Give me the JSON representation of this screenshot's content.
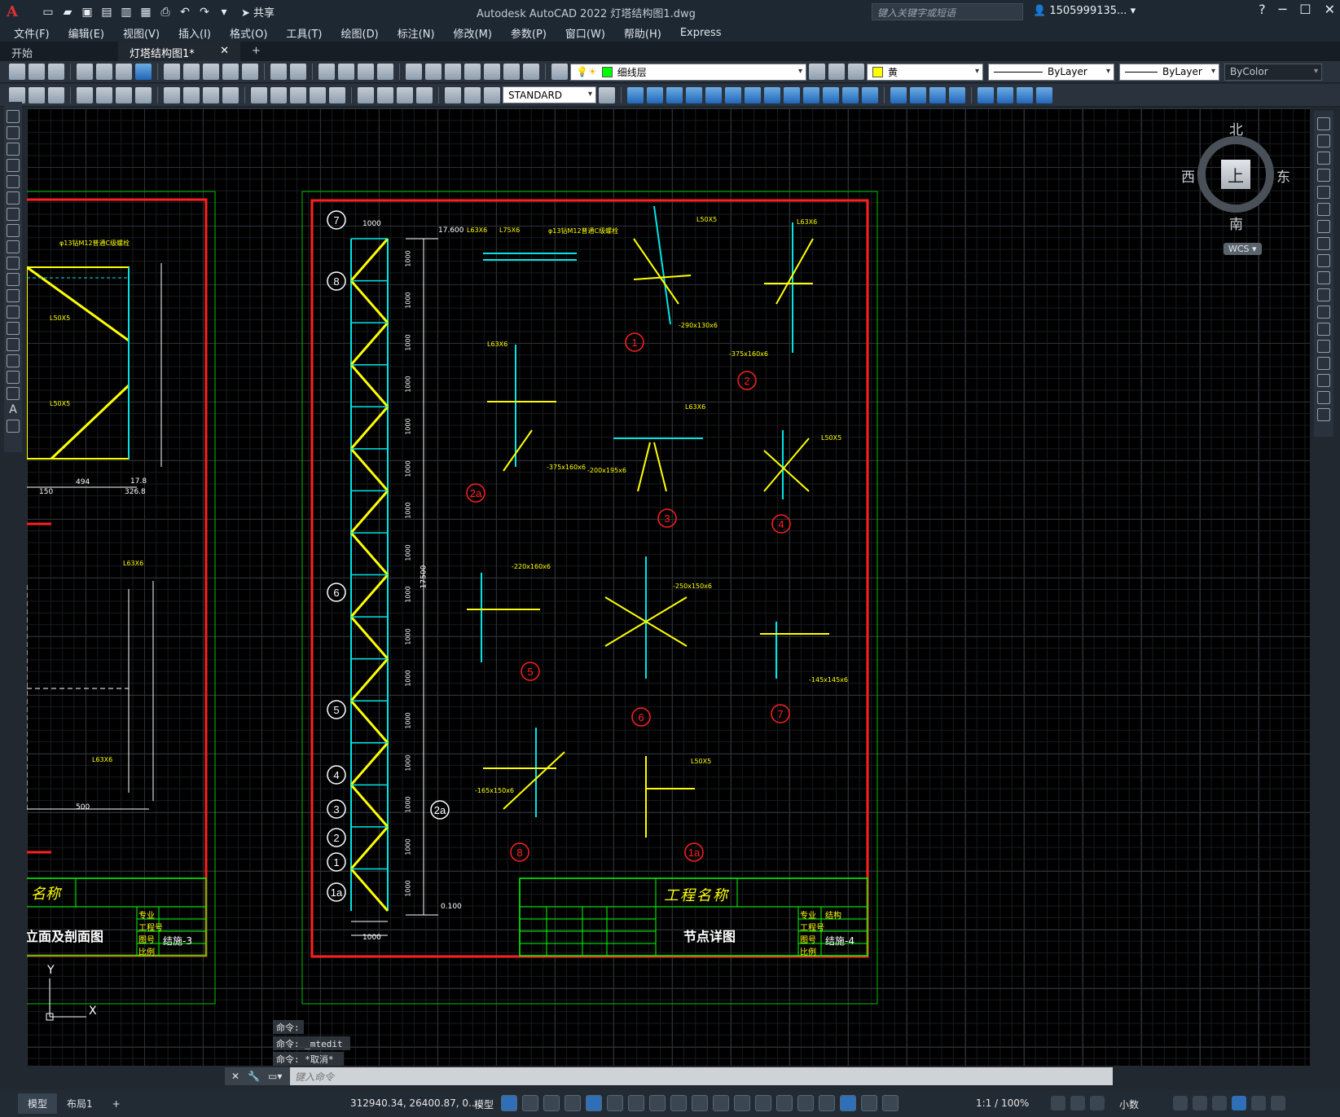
{
  "app": {
    "logo": "A",
    "title": "Autodesk AutoCAD 2022    灯塔结构图1.dwg",
    "share": "共享",
    "search_placeholder": "键入关键字或短语",
    "user": "1505999135...",
    "help": "?"
  },
  "menu": [
    "文件(F)",
    "编辑(E)",
    "视图(V)",
    "插入(I)",
    "格式(O)",
    "工具(T)",
    "绘图(D)",
    "标注(N)",
    "修改(M)",
    "参数(P)",
    "窗口(W)",
    "帮助(H)",
    "Express"
  ],
  "tabs": [
    {
      "label": "开始",
      "active": false
    },
    {
      "label": "灯塔结构图1*",
      "active": true
    }
  ],
  "toolbar": {
    "layer": "细线层",
    "layer_color": "#00ff00",
    "color": "黄",
    "color_swatch": "#ffff00",
    "linetype": "ByLayer",
    "lineweight": "ByLayer",
    "plotstyle": "ByColor",
    "textstyle": "STANDARD"
  },
  "viewcube": {
    "north": "北",
    "south": "南",
    "east": "东",
    "west": "西",
    "face": "上",
    "wcs": "WCS"
  },
  "drawing": {
    "left_sheet": {
      "title": "立面及剖面图",
      "project": "名称",
      "sheet_no": "结施-3",
      "labels": [
        "专业",
        "工程号",
        "图号",
        "比例"
      ]
    },
    "right_sheet": {
      "project": "工程名称",
      "title": "节点详图",
      "discipline": "结构",
      "sheet_no": "结施-4",
      "labels": [
        "专业",
        "工程号",
        "图号",
        "比例"
      ]
    },
    "elev_top": "17.600",
    "elev_bottom": "0.100",
    "height_total": "17500",
    "tower_width": "1000",
    "node_labels": [
      "7",
      "8",
      "6",
      "5",
      "4",
      "3",
      "2",
      "1",
      "1a",
      "2a"
    ],
    "detail_labels": [
      "1",
      "2",
      "2a",
      "3",
      "4",
      "5",
      "6",
      "7",
      "8",
      "1a"
    ],
    "member_labels": [
      "L63X6",
      "L50X5",
      "L75X6",
      "-290x130x6",
      "-375x160x6",
      "-200x195x6",
      "-220x160x6",
      "-250x150x6",
      "-145x145x6",
      "-165x150x6",
      "φ13钻M12普通C级螺栓"
    ],
    "tower_spacing": [
      "1000",
      "1000",
      "1000",
      "1000",
      "1000",
      "1000",
      "1000",
      "1000",
      "1000",
      "1000",
      "1000",
      "1000",
      "1000",
      "1000",
      "1000",
      "1000"
    ],
    "left_dims": [
      "494",
      "326.8",
      "150",
      "17.8",
      "500"
    ],
    "axis_y": "Y",
    "axis_x": "X"
  },
  "command": {
    "history": [
      "命令:",
      "命令: _mtedit",
      "命令: *取消*"
    ],
    "placeholder": "键入命令"
  },
  "status": {
    "layouts": [
      "模型",
      "布局1"
    ],
    "coords": "312940.34, 26400.87, 0....",
    "model": "模型",
    "scale": "1:1 / 100%",
    "units": "小数"
  }
}
